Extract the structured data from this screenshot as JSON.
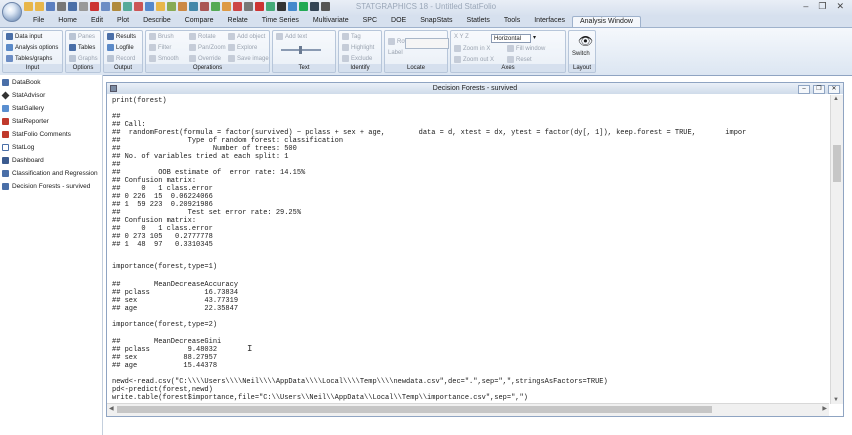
{
  "app": {
    "window_title": "STATGRAPHICS 18 - Untitled StatFolio",
    "colors": {
      "ribbon": "#dce6f2",
      "titlebar": "#cfdbea",
      "active_tab_border": "#9fb2cc"
    }
  },
  "window_controls": {
    "minimize": "–",
    "restore": "❐",
    "close": "✕"
  },
  "menu_tabs": [
    "File",
    "Home",
    "Edit",
    "Plot",
    "Describe",
    "Compare",
    "Relate",
    "Time Series",
    "Multivariate",
    "SPC",
    "DOE",
    "SnapStats",
    "Statlets",
    "Tools",
    "Interfaces",
    "Analysis Window"
  ],
  "ribbon": {
    "input": {
      "label": "Input",
      "items": [
        "Data input",
        "Analysis options",
        "Tables/graphs"
      ]
    },
    "options": {
      "label": "Options",
      "items": [
        "Panes",
        "Tables",
        "Graphs"
      ]
    },
    "output": {
      "label": "Output",
      "items": [
        "Results",
        "Logfile",
        "Record"
      ]
    },
    "operations": {
      "label": "Operations",
      "items": [
        "Brush",
        "Rotate",
        "Add object",
        "Filter",
        "Pan/Zoom",
        "Explore",
        "Smooth",
        "Override",
        "Save image"
      ]
    },
    "text": {
      "label": "Text",
      "items": [
        "Add text"
      ]
    },
    "identify": {
      "label": "Identify",
      "items": [
        "Tag",
        "Highlight",
        "Exclude"
      ]
    },
    "locate": {
      "label": "Locate",
      "items": [
        "Row",
        "Label"
      ]
    },
    "axes": {
      "label": "Axes",
      "items": [
        "X   Y   Z",
        "Horizontal",
        "Zoom in X",
        "Fill window",
        "Zoom out X",
        "Reset"
      ]
    },
    "layout": {
      "label": "Layout",
      "items": [
        "Switch"
      ]
    }
  },
  "sidebar": {
    "items": [
      "DataBook",
      "StatAdvisor",
      "StatGallery",
      "StatReporter",
      "StatFolio Comments",
      "StatLog",
      "Dashboard",
      "Classification and Regression",
      "Decision Forests - survived"
    ]
  },
  "document": {
    "title": "Decision Forests - survived",
    "lines": [
      "print(forest)",
      "",
      "##",
      "## Call:",
      "##  randomForest(formula = factor(survived) ~ pclass + sex + age,        data = d, xtest = dx, ytest = factor(dy[, 1]), keep.forest = TRUE,       impor",
      "##                Type of random forest: classification",
      "##                      Number of trees: 500",
      "## No. of variables tried at each split: 1",
      "##",
      "##         OOB estimate of  error rate: 14.15%",
      "## Confusion matrix:",
      "##     0   1 class.error",
      "## 0 226  15  0.06224066",
      "## 1  59 223  0.20921986",
      "##                Test set error rate: 29.25%",
      "## Confusion matrix:",
      "##     0   1 class.error",
      "## 0 273 105   0.2777778",
      "## 1  48  97   0.3310345",
      "",
      "importance(forest,type=1)",
      "",
      "##        MeanDecreaseAccuracy",
      "## pclass             16.73834",
      "## sex                43.77319",
      "## age                22.35847",
      "",
      "importance(forest,type=2)",
      "",
      "##        MeanDecreaseGini",
      "## pclass         9.48032",
      "## sex           88.27957",
      "## age           15.44378",
      "",
      "newd<-read.csv(\"C:\\\\\\\\Users\\\\\\\\Neil\\\\\\\\AppData\\\\\\\\Local\\\\\\\\Temp\\\\\\\\newdata.csv\",dec=\".\",sep=\",\",stringsAsFactors=TRUE)",
      "pd<-predict(forest,newd)",
      "write.table(forest$importance,file=\"C:\\\\Users\\\\Neil\\\\AppData\\\\Local\\\\Temp\\\\importance.csv\",sep=\",\")"
    ]
  }
}
